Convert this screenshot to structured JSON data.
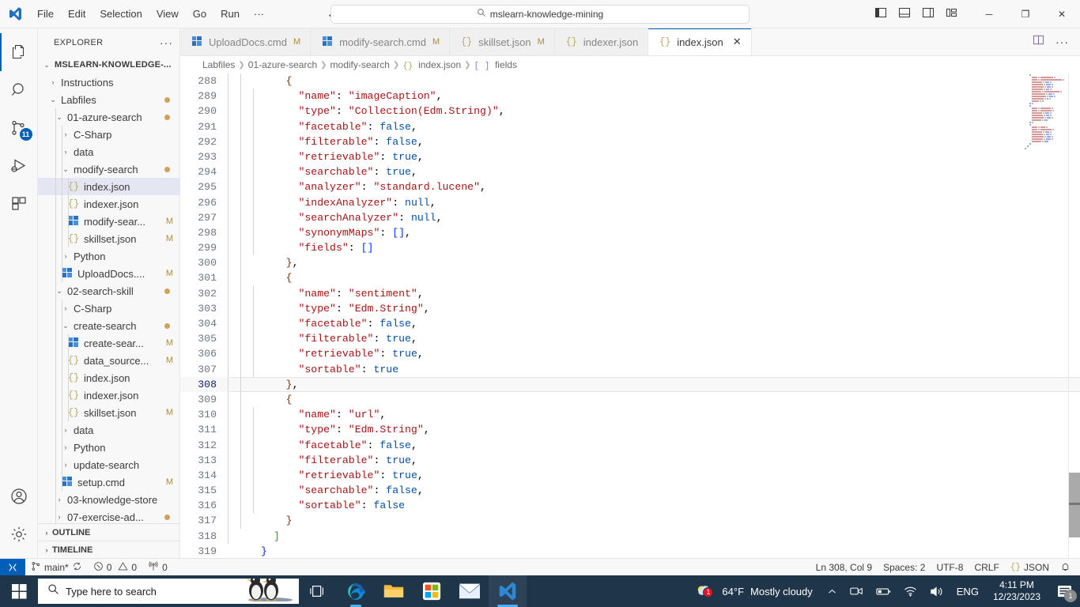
{
  "titlebar": {
    "logo_icon": "vscode-logo-icon",
    "menus": [
      "File",
      "Edit",
      "Selection",
      "View",
      "Go",
      "Run",
      "···"
    ],
    "back_icon": "arrow-left-icon",
    "forward_icon": "arrow-right-icon",
    "command_center": {
      "search_icon": "search-icon",
      "value": "mslearn-knowledge-mining"
    },
    "layout_icons": [
      "toggle-primary-sidebar-icon",
      "toggle-panel-icon",
      "toggle-secondary-sidebar-icon",
      "customize-layout-icon"
    ],
    "window_buttons": {
      "minimize": "─",
      "maximize": "❐",
      "close": "✕"
    }
  },
  "activitybar": {
    "items": [
      {
        "name": "explorer-icon",
        "active": true,
        "badge": ""
      },
      {
        "name": "search-icon",
        "active": false,
        "badge": ""
      },
      {
        "name": "source-control-icon",
        "active": false,
        "badge": "11"
      },
      {
        "name": "run-and-debug-icon",
        "active": false,
        "badge": ""
      },
      {
        "name": "extensions-icon",
        "active": false,
        "badge": ""
      }
    ],
    "bottom": [
      {
        "name": "accounts-icon"
      },
      {
        "name": "manage-settings-gear-icon"
      }
    ]
  },
  "sidebar": {
    "title": "EXPLORER",
    "more_actions": "···",
    "tree": [
      {
        "label": "MSLEARN-KNOWLEDGE-...",
        "depth": 0,
        "kind": "root",
        "chevron": "⌄",
        "state": "expanded"
      },
      {
        "label": "Instructions",
        "depth": 1,
        "kind": "folder",
        "chevron": "›",
        "state": "collapsed"
      },
      {
        "label": "Labfiles",
        "depth": 1,
        "kind": "folder",
        "chevron": "⌄",
        "state": "expanded",
        "dot": true
      },
      {
        "label": "01-azure-search",
        "depth": 2,
        "kind": "folder",
        "chevron": "⌄",
        "state": "expanded",
        "dot": true
      },
      {
        "label": "C-Sharp",
        "depth": 3,
        "kind": "folder",
        "chevron": "›",
        "state": "collapsed"
      },
      {
        "label": "data",
        "depth": 3,
        "kind": "folder",
        "chevron": "›",
        "state": "collapsed"
      },
      {
        "label": "modify-search",
        "depth": 3,
        "kind": "folder",
        "chevron": "⌄",
        "state": "expanded",
        "dot": true
      },
      {
        "label": "index.json",
        "depth": 4,
        "kind": "json",
        "selected": true
      },
      {
        "label": "indexer.json",
        "depth": 4,
        "kind": "json"
      },
      {
        "label": "modify-sear...",
        "depth": 4,
        "kind": "cmd",
        "status": "M"
      },
      {
        "label": "skillset.json",
        "depth": 4,
        "kind": "json",
        "status": "M"
      },
      {
        "label": "Python",
        "depth": 3,
        "kind": "folder",
        "chevron": "›",
        "state": "collapsed"
      },
      {
        "label": "UploadDocs....",
        "depth": 3,
        "kind": "cmd",
        "status": "M"
      },
      {
        "label": "02-search-skill",
        "depth": 2,
        "kind": "folder",
        "chevron": "⌄",
        "state": "expanded",
        "dot": true
      },
      {
        "label": "C-Sharp",
        "depth": 3,
        "kind": "folder",
        "chevron": "›",
        "state": "collapsed"
      },
      {
        "label": "create-search",
        "depth": 3,
        "kind": "folder",
        "chevron": "⌄",
        "state": "expanded",
        "dot": true
      },
      {
        "label": "create-sear...",
        "depth": 4,
        "kind": "cmd",
        "status": "M"
      },
      {
        "label": "data_source...",
        "depth": 4,
        "kind": "json",
        "status": "M"
      },
      {
        "label": "index.json",
        "depth": 4,
        "kind": "json"
      },
      {
        "label": "indexer.json",
        "depth": 4,
        "kind": "json"
      },
      {
        "label": "skillset.json",
        "depth": 4,
        "kind": "json",
        "status": "M"
      },
      {
        "label": "data",
        "depth": 3,
        "kind": "folder",
        "chevron": "›",
        "state": "collapsed"
      },
      {
        "label": "Python",
        "depth": 3,
        "kind": "folder",
        "chevron": "›",
        "state": "collapsed"
      },
      {
        "label": "update-search",
        "depth": 3,
        "kind": "folder",
        "chevron": "›",
        "state": "collapsed"
      },
      {
        "label": "setup.cmd",
        "depth": 3,
        "kind": "cmd",
        "status": "M"
      },
      {
        "label": "03-knowledge-store",
        "depth": 2,
        "kind": "folder",
        "chevron": "›",
        "state": "collapsed"
      },
      {
        "label": "07-exercise-ad...",
        "depth": 2,
        "kind": "folder",
        "chevron": "›",
        "state": "collapsed",
        "dot": true
      }
    ],
    "sections": [
      {
        "label": "OUTLINE",
        "chevron": "›"
      },
      {
        "label": "TIMELINE",
        "chevron": "›"
      }
    ]
  },
  "tabs": [
    {
      "label": "UploadDocs.cmd",
      "icon": "cmd-file-icon",
      "status": "M",
      "active": false,
      "closable": false
    },
    {
      "label": "modify-search.cmd",
      "icon": "cmd-file-icon",
      "status": "M",
      "active": false,
      "closable": false
    },
    {
      "label": "skillset.json",
      "icon": "json-file-icon",
      "status": "M",
      "active": false,
      "closable": false
    },
    {
      "label": "indexer.json",
      "icon": "json-file-icon",
      "status": "",
      "active": false,
      "closable": false
    },
    {
      "label": "index.json",
      "icon": "json-file-icon",
      "status": "",
      "active": true,
      "closable": true,
      "close_icon": "✕"
    }
  ],
  "tab_actions": [
    "split-editor-icon",
    "more-actions-icon"
  ],
  "breadcrumb": [
    {
      "label": "Labfiles",
      "icon": ""
    },
    {
      "label": "01-azure-search",
      "icon": ""
    },
    {
      "label": "modify-search",
      "icon": ""
    },
    {
      "label": "index.json",
      "icon": "{}"
    },
    {
      "label": "fields",
      "icon": "[ ]"
    }
  ],
  "editor": {
    "first_line": 288,
    "current_line": 308,
    "lines": [
      {
        "n": 288,
        "indent": 2,
        "tokens": [
          {
            "t": "{",
            "c": "br2"
          }
        ]
      },
      {
        "n": 289,
        "indent": 3,
        "tokens": [
          {
            "t": "\"name\"",
            "c": "k"
          },
          {
            "t": ": ",
            "c": "p"
          },
          {
            "t": "\"imageCaption\"",
            "c": "s"
          },
          {
            "t": ",",
            "c": "p"
          }
        ]
      },
      {
        "n": 290,
        "indent": 3,
        "tokens": [
          {
            "t": "\"type\"",
            "c": "k"
          },
          {
            "t": ": ",
            "c": "p"
          },
          {
            "t": "\"Collection(Edm.String)\"",
            "c": "s"
          },
          {
            "t": ",",
            "c": "p"
          }
        ]
      },
      {
        "n": 291,
        "indent": 3,
        "tokens": [
          {
            "t": "\"facetable\"",
            "c": "k"
          },
          {
            "t": ": ",
            "c": "p"
          },
          {
            "t": "false",
            "c": "b"
          },
          {
            "t": ",",
            "c": "p"
          }
        ]
      },
      {
        "n": 292,
        "indent": 3,
        "tokens": [
          {
            "t": "\"filterable\"",
            "c": "k"
          },
          {
            "t": ": ",
            "c": "p"
          },
          {
            "t": "false",
            "c": "b"
          },
          {
            "t": ",",
            "c": "p"
          }
        ]
      },
      {
        "n": 293,
        "indent": 3,
        "tokens": [
          {
            "t": "\"retrievable\"",
            "c": "k"
          },
          {
            "t": ": ",
            "c": "p"
          },
          {
            "t": "true",
            "c": "b"
          },
          {
            "t": ",",
            "c": "p"
          }
        ]
      },
      {
        "n": 294,
        "indent": 3,
        "tokens": [
          {
            "t": "\"searchable\"",
            "c": "k"
          },
          {
            "t": ": ",
            "c": "p"
          },
          {
            "t": "true",
            "c": "b"
          },
          {
            "t": ",",
            "c": "p"
          }
        ]
      },
      {
        "n": 295,
        "indent": 3,
        "tokens": [
          {
            "t": "\"analyzer\"",
            "c": "k"
          },
          {
            "t": ": ",
            "c": "p"
          },
          {
            "t": "\"standard.lucene\"",
            "c": "s"
          },
          {
            "t": ",",
            "c": "p"
          }
        ]
      },
      {
        "n": 296,
        "indent": 3,
        "tokens": [
          {
            "t": "\"indexAnalyzer\"",
            "c": "k"
          },
          {
            "t": ": ",
            "c": "p"
          },
          {
            "t": "null",
            "c": "b"
          },
          {
            "t": ",",
            "c": "p"
          }
        ]
      },
      {
        "n": 297,
        "indent": 3,
        "tokens": [
          {
            "t": "\"searchAnalyzer\"",
            "c": "k"
          },
          {
            "t": ": ",
            "c": "p"
          },
          {
            "t": "null",
            "c": "b"
          },
          {
            "t": ",",
            "c": "p"
          }
        ]
      },
      {
        "n": 298,
        "indent": 3,
        "tokens": [
          {
            "t": "\"synonymMaps\"",
            "c": "k"
          },
          {
            "t": ": ",
            "c": "p"
          },
          {
            "t": "[]",
            "c": "br0"
          },
          {
            "t": ",",
            "c": "p"
          }
        ]
      },
      {
        "n": 299,
        "indent": 3,
        "tokens": [
          {
            "t": "\"fields\"",
            "c": "k"
          },
          {
            "t": ": ",
            "c": "p"
          },
          {
            "t": "[]",
            "c": "br0"
          }
        ]
      },
      {
        "n": 300,
        "indent": 2,
        "tokens": [
          {
            "t": "}",
            "c": "br2"
          },
          {
            "t": ",",
            "c": "p"
          }
        ]
      },
      {
        "n": 301,
        "indent": 2,
        "tokens": [
          {
            "t": "{",
            "c": "br2"
          }
        ]
      },
      {
        "n": 302,
        "indent": 3,
        "tokens": [
          {
            "t": "\"name\"",
            "c": "k"
          },
          {
            "t": ": ",
            "c": "p"
          },
          {
            "t": "\"sentiment\"",
            "c": "s"
          },
          {
            "t": ",",
            "c": "p"
          }
        ]
      },
      {
        "n": 303,
        "indent": 3,
        "tokens": [
          {
            "t": "\"type\"",
            "c": "k"
          },
          {
            "t": ": ",
            "c": "p"
          },
          {
            "t": "\"Edm.String\"",
            "c": "s"
          },
          {
            "t": ",",
            "c": "p"
          }
        ]
      },
      {
        "n": 304,
        "indent": 3,
        "tokens": [
          {
            "t": "\"facetable\"",
            "c": "k"
          },
          {
            "t": ": ",
            "c": "p"
          },
          {
            "t": "false",
            "c": "b"
          },
          {
            "t": ",",
            "c": "p"
          }
        ]
      },
      {
        "n": 305,
        "indent": 3,
        "tokens": [
          {
            "t": "\"filterable\"",
            "c": "k"
          },
          {
            "t": ": ",
            "c": "p"
          },
          {
            "t": "true",
            "c": "b"
          },
          {
            "t": ",",
            "c": "p"
          }
        ]
      },
      {
        "n": 306,
        "indent": 3,
        "tokens": [
          {
            "t": "\"retrievable\"",
            "c": "k"
          },
          {
            "t": ": ",
            "c": "p"
          },
          {
            "t": "true",
            "c": "b"
          },
          {
            "t": ",",
            "c": "p"
          }
        ]
      },
      {
        "n": 307,
        "indent": 3,
        "tokens": [
          {
            "t": "\"sortable\"",
            "c": "k"
          },
          {
            "t": ": ",
            "c": "p"
          },
          {
            "t": "true",
            "c": "b"
          }
        ]
      },
      {
        "n": 308,
        "indent": 2,
        "current": true,
        "tokens": [
          {
            "t": "}",
            "c": "br2"
          },
          {
            "t": ",",
            "c": "p"
          }
        ]
      },
      {
        "n": 309,
        "indent": 2,
        "tokens": [
          {
            "t": "{",
            "c": "br2"
          }
        ]
      },
      {
        "n": 310,
        "indent": 3,
        "tokens": [
          {
            "t": "\"name\"",
            "c": "k"
          },
          {
            "t": ": ",
            "c": "p"
          },
          {
            "t": "\"url\"",
            "c": "s"
          },
          {
            "t": ",",
            "c": "p"
          }
        ]
      },
      {
        "n": 311,
        "indent": 3,
        "tokens": [
          {
            "t": "\"type\"",
            "c": "k"
          },
          {
            "t": ": ",
            "c": "p"
          },
          {
            "t": "\"Edm.String\"",
            "c": "s"
          },
          {
            "t": ",",
            "c": "p"
          }
        ]
      },
      {
        "n": 312,
        "indent": 3,
        "tokens": [
          {
            "t": "\"facetable\"",
            "c": "k"
          },
          {
            "t": ": ",
            "c": "p"
          },
          {
            "t": "false",
            "c": "b"
          },
          {
            "t": ",",
            "c": "p"
          }
        ]
      },
      {
        "n": 313,
        "indent": 3,
        "tokens": [
          {
            "t": "\"filterable\"",
            "c": "k"
          },
          {
            "t": ": ",
            "c": "p"
          },
          {
            "t": "true",
            "c": "b"
          },
          {
            "t": ",",
            "c": "p"
          }
        ]
      },
      {
        "n": 314,
        "indent": 3,
        "tokens": [
          {
            "t": "\"retrievable\"",
            "c": "k"
          },
          {
            "t": ": ",
            "c": "p"
          },
          {
            "t": "true",
            "c": "b"
          },
          {
            "t": ",",
            "c": "p"
          }
        ]
      },
      {
        "n": 315,
        "indent": 3,
        "tokens": [
          {
            "t": "\"searchable\"",
            "c": "k"
          },
          {
            "t": ": ",
            "c": "p"
          },
          {
            "t": "false",
            "c": "b"
          },
          {
            "t": ",",
            "c": "p"
          }
        ]
      },
      {
        "n": 316,
        "indent": 3,
        "tokens": [
          {
            "t": "\"sortable\"",
            "c": "k"
          },
          {
            "t": ": ",
            "c": "p"
          },
          {
            "t": "false",
            "c": "b"
          }
        ]
      },
      {
        "n": 317,
        "indent": 2,
        "tokens": [
          {
            "t": "}",
            "c": "br2"
          }
        ]
      },
      {
        "n": 318,
        "indent": 1,
        "tokens": [
          {
            "t": "]",
            "c": "br1"
          }
        ]
      },
      {
        "n": 319,
        "indent": 0,
        "tokens": [
          {
            "t": "}",
            "c": "br0"
          }
        ]
      }
    ]
  },
  "statusbar": {
    "remote_icon": "remote-window-icon",
    "branch_icon": "source-control-branch-icon",
    "branch": "main*",
    "sync_icon": "sync-icon",
    "errors_icon": "error-icon",
    "errors": "0",
    "warnings_icon": "warning-icon",
    "warnings": "0",
    "ports_icon": "radio-tower-icon",
    "ports": "0",
    "cursor_position": "Ln 308, Col 9",
    "indentation": "Spaces: 2",
    "encoding": "UTF-8",
    "eol": "CRLF",
    "language_icon": "{}",
    "language": "JSON",
    "bell_icon": "notifications-bell-icon"
  },
  "taskbar": {
    "start_icon": "windows-start-icon",
    "search_placeholder": "Type here to search",
    "search_icon": "search-icon",
    "decoration": "penguins-image",
    "apps": [
      {
        "name": "task-view-icon",
        "running": false,
        "active": false
      },
      {
        "name": "microsoft-edge-icon",
        "running": true,
        "active": false
      },
      {
        "name": "file-explorer-icon",
        "running": false,
        "active": false
      },
      {
        "name": "microsoft-store-icon",
        "running": false,
        "active": false
      },
      {
        "name": "mail-icon",
        "running": false,
        "active": false
      },
      {
        "name": "visual-studio-code-icon",
        "running": true,
        "active": true
      }
    ],
    "tray": {
      "weather_icon": "cloud-weather-icon",
      "weather_badge": "1",
      "temperature": "64°F",
      "condition": "Mostly cloudy",
      "chevron_icon": "chevron-up-icon",
      "icons": [
        "meet-now-icon",
        "battery-icon",
        "wifi-icon",
        "volume-icon"
      ],
      "language": "ENG",
      "time": "4:11 PM",
      "date": "12/23/2023",
      "notification_icon": "notification-center-icon",
      "notification_count": "1"
    }
  },
  "colors": {
    "accent": "#005fb8",
    "taskbar_bg": "#1f3549",
    "modified_badge": "#b08a3e",
    "json_key": "#a31515",
    "json_value": "#0451a5"
  }
}
